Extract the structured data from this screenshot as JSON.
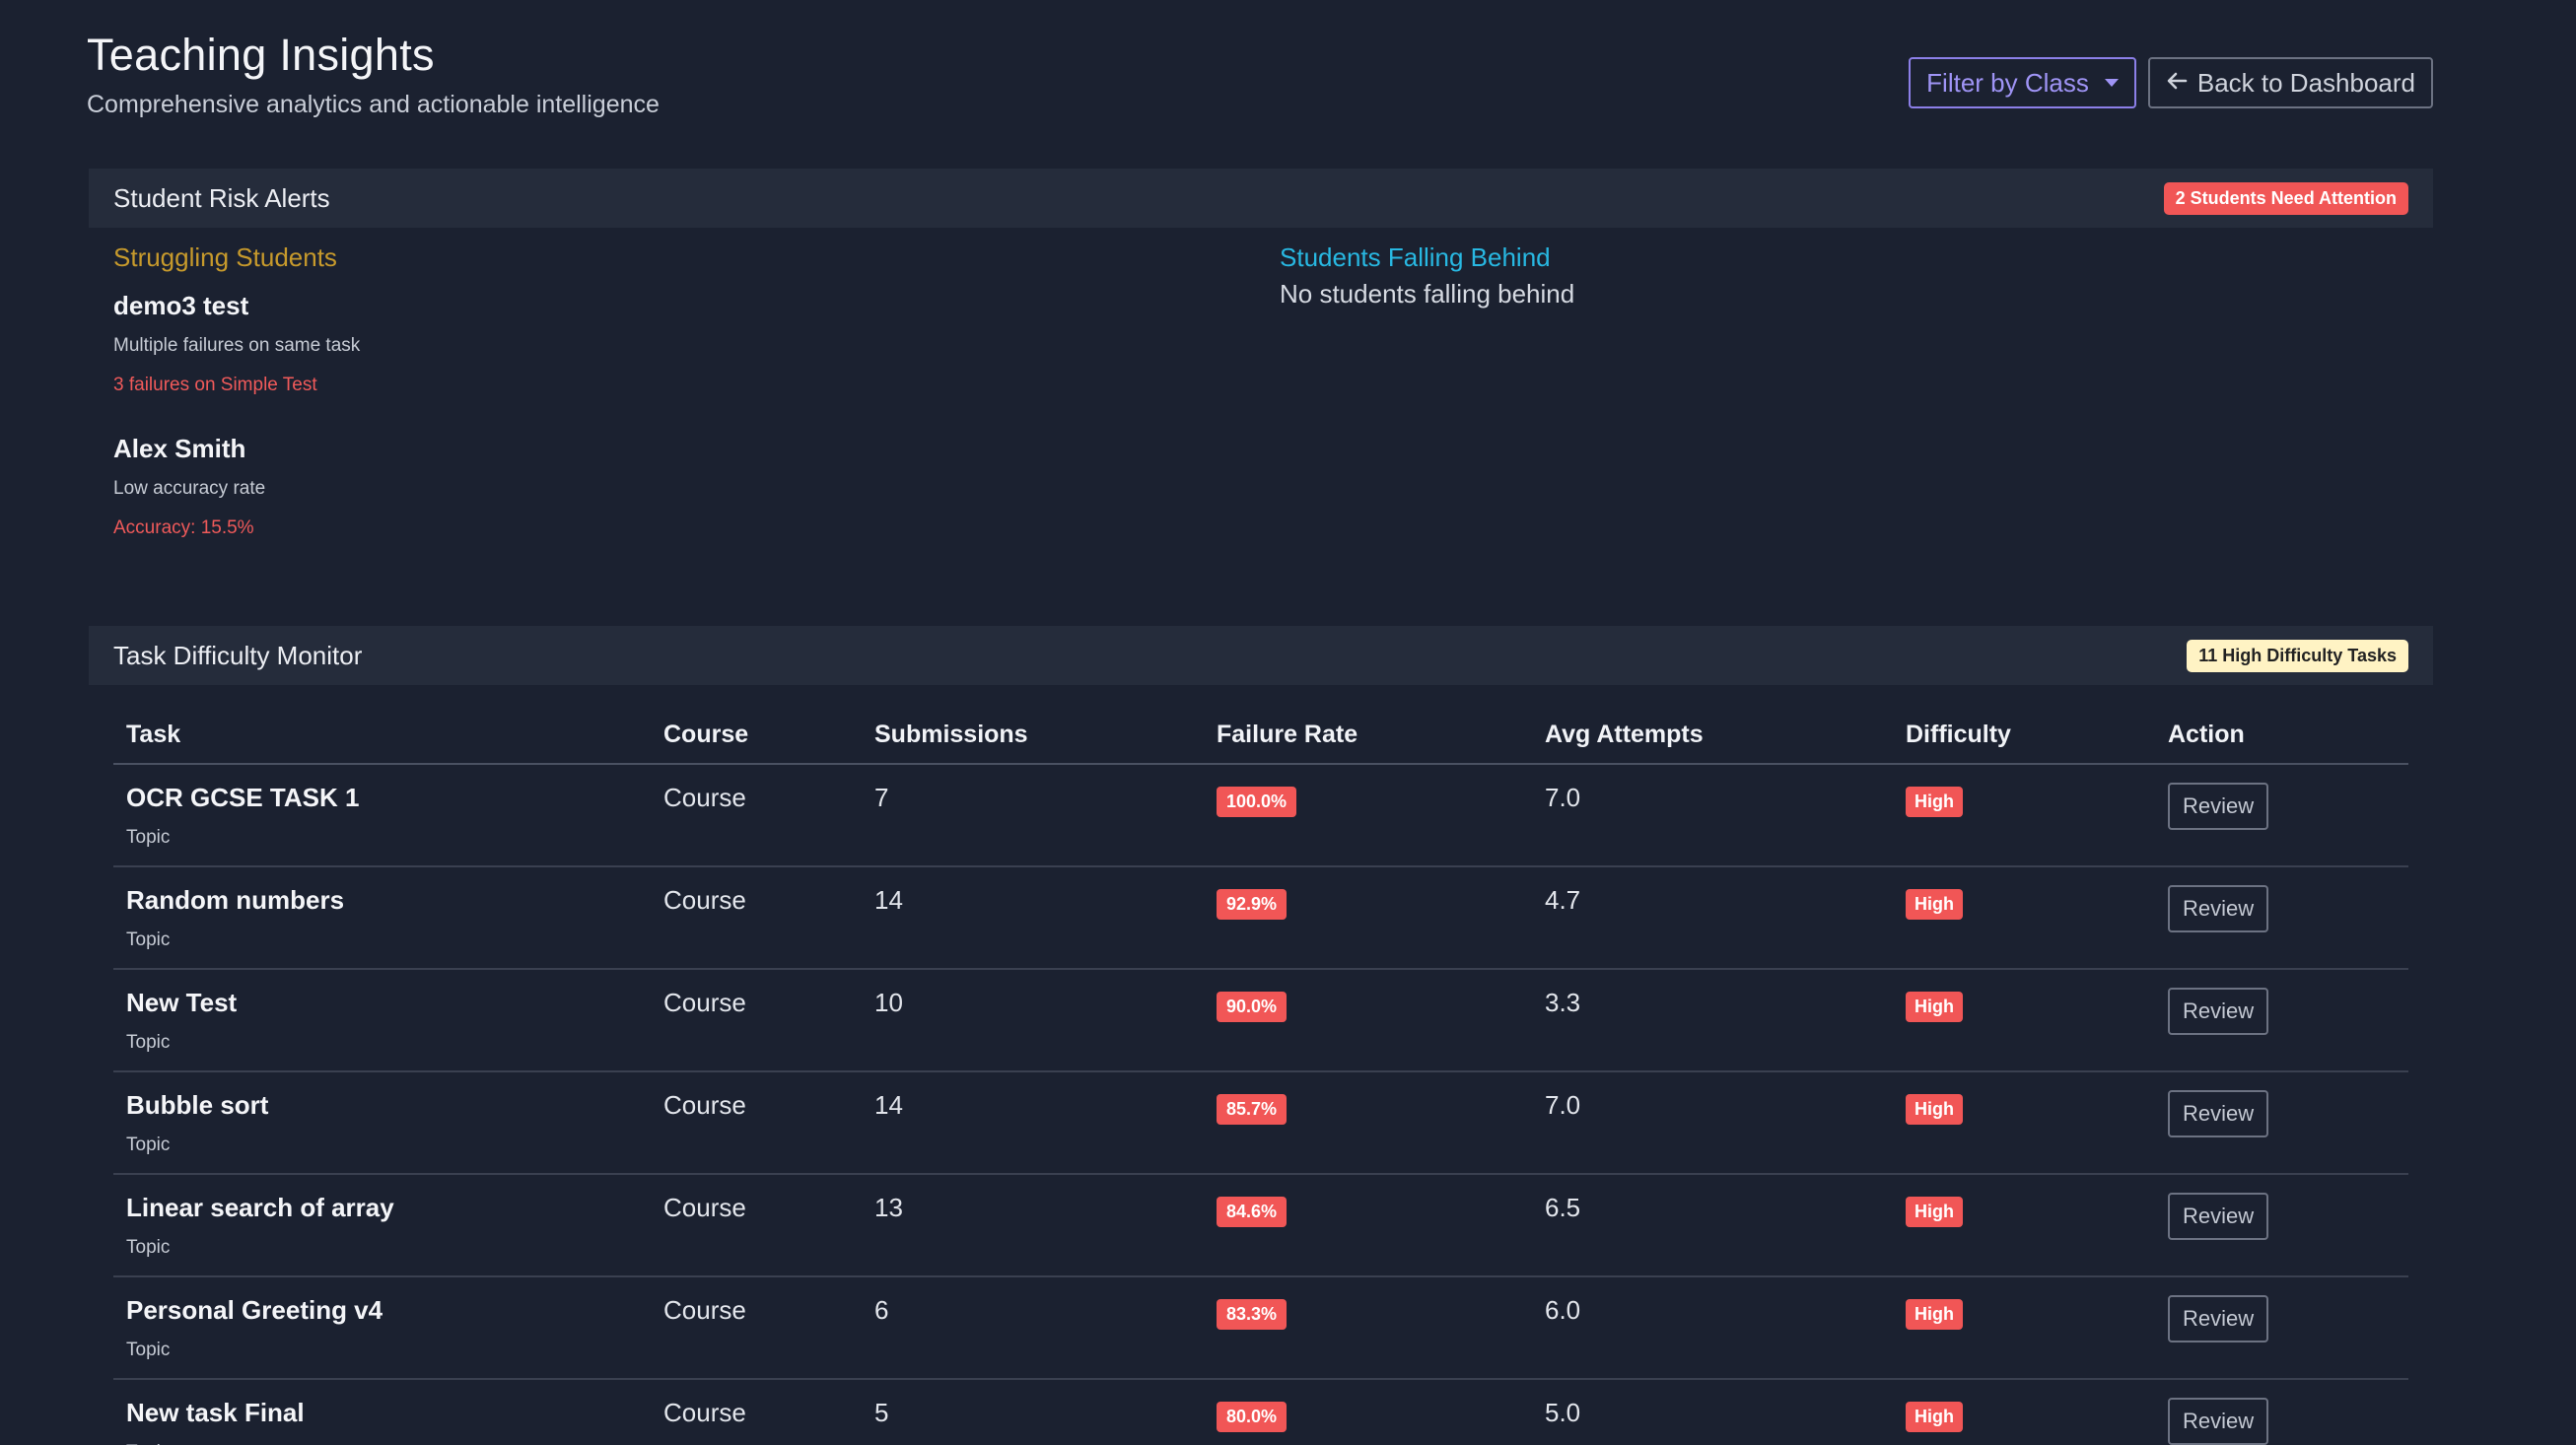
{
  "header": {
    "title": "Teaching Insights",
    "subtitle": "Comprehensive analytics and actionable intelligence",
    "filter_label": "Filter by Class",
    "back_label": "Back to Dashboard"
  },
  "risk_alerts": {
    "title": "Student Risk Alerts",
    "badge": "2 Students Need Attention",
    "struggling_title": "Struggling Students",
    "struggling": [
      {
        "name": "demo3 test",
        "reason": "Multiple failures on same task",
        "detail": "3 failures on Simple Test"
      },
      {
        "name": "Alex Smith",
        "reason": "Low accuracy rate",
        "detail": "Accuracy: 15.5%"
      }
    ],
    "behind_title": "Students Falling Behind",
    "behind_empty": "No students falling behind"
  },
  "task_monitor": {
    "title": "Task Difficulty Monitor",
    "badge": "11 High Difficulty Tasks",
    "columns": [
      "Task",
      "Course",
      "Submissions",
      "Failure Rate",
      "Avg Attempts",
      "Difficulty",
      "Action"
    ],
    "rows": [
      {
        "task": "OCR GCSE TASK 1",
        "topic": "Topic",
        "course": "Course",
        "submissions": "7",
        "failure_rate": "100.0%",
        "avg_attempts": "7.0",
        "difficulty": "High",
        "action": "Review"
      },
      {
        "task": "Random numbers",
        "topic": "Topic",
        "course": "Course",
        "submissions": "14",
        "failure_rate": "92.9%",
        "avg_attempts": "4.7",
        "difficulty": "High",
        "action": "Review"
      },
      {
        "task": "New Test",
        "topic": "Topic",
        "course": "Course",
        "submissions": "10",
        "failure_rate": "90.0%",
        "avg_attempts": "3.3",
        "difficulty": "High",
        "action": "Review"
      },
      {
        "task": "Bubble sort",
        "topic": "Topic",
        "course": "Course",
        "submissions": "14",
        "failure_rate": "85.7%",
        "avg_attempts": "7.0",
        "difficulty": "High",
        "action": "Review"
      },
      {
        "task": "Linear search of array",
        "topic": "Topic",
        "course": "Course",
        "submissions": "13",
        "failure_rate": "84.6%",
        "avg_attempts": "6.5",
        "difficulty": "High",
        "action": "Review"
      },
      {
        "task": "Personal Greeting v4",
        "topic": "Topic",
        "course": "Course",
        "submissions": "6",
        "failure_rate": "83.3%",
        "avg_attempts": "6.0",
        "difficulty": "High",
        "action": "Review"
      },
      {
        "task": "New task Final",
        "topic": "Topic",
        "course": "Course",
        "submissions": "5",
        "failure_rate": "80.0%",
        "avg_attempts": "5.0",
        "difficulty": "High",
        "action": "Review"
      }
    ]
  },
  "colors": {
    "background": "#1b2130",
    "card_header": "#252c3b",
    "danger": "#f15656",
    "warning_badge": "#fff3c4",
    "accent_purple": "#9f94f5",
    "struggling_title": "#c79a2c",
    "behind_title": "#28b8e2"
  },
  "icons": {
    "filter_caret": "caret-down-icon",
    "back_arrow": "arrow-left-icon"
  }
}
